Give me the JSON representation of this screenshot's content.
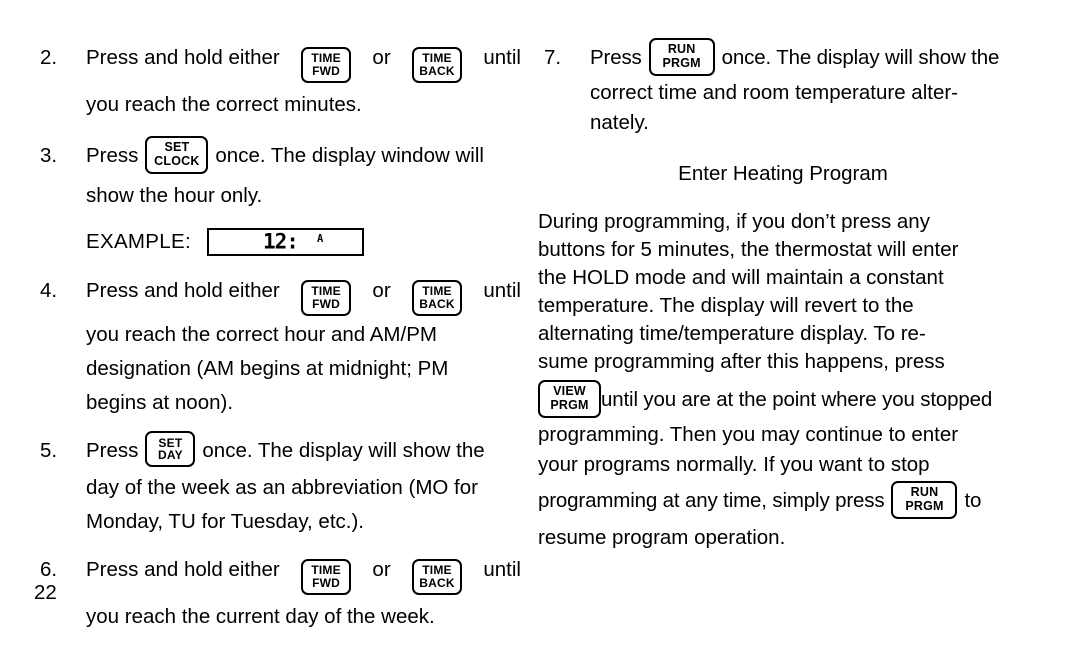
{
  "page": {
    "number": "22",
    "background_color": "#ffffff",
    "text_color": "#000000"
  },
  "keys": {
    "time_fwd": {
      "line1": "TIME",
      "line2": "FWD"
    },
    "time_back": {
      "line1": "TIME",
      "line2": "BACK"
    },
    "set_clock": {
      "line1": "SET",
      "line2": "CLOCK"
    },
    "set_day": {
      "line1": "SET",
      "line2": "DAY"
    },
    "run_prgm": {
      "line1": "RUN",
      "line2": "PRGM"
    },
    "view_prgm": {
      "line1": "VIEW",
      "line2": "PRGM"
    }
  },
  "left_column": {
    "steps": [
      {
        "number": "2.",
        "lines": [
          {
            "pre": "Press and hold either",
            "key": "time_fwd",
            "mid": "or",
            "key2": "time_back",
            "post": "until"
          },
          {
            "text": "you reach the correct minutes."
          }
        ]
      },
      {
        "number": "3.",
        "lines": [
          {
            "pre": "Press",
            "key": "set_clock",
            "post": "once. The display window will"
          },
          {
            "text": "show the hour only."
          }
        ]
      },
      {
        "number": "4.",
        "lines": [
          {
            "pre": "Press and hold either",
            "key": "time_fwd",
            "mid": "or",
            "key2": "time_back",
            "post": "until"
          },
          {
            "text": "you reach the correct hour and AM/PM"
          },
          {
            "text": "designation (AM begins at midnight; PM"
          },
          {
            "text": "begins at noon)."
          }
        ]
      },
      {
        "number": "5.",
        "lines": [
          {
            "pre": "Press",
            "key": "set_day",
            "post": "once. The display will show the"
          },
          {
            "text": "day of the week as an abbreviation (MO for"
          },
          {
            "text": "Monday, TU for Tuesday, etc.)."
          }
        ]
      },
      {
        "number": "6.",
        "lines": [
          {
            "pre": "Press and hold either",
            "key": "time_fwd",
            "mid": "or",
            "key2": "time_back",
            "post": "until"
          },
          {
            "text": "you reach the current day of the week."
          }
        ]
      }
    ],
    "example": {
      "label": "EXAMPLE:",
      "display_time": "12:",
      "display_ampm": "A"
    }
  },
  "right_column": {
    "step7": {
      "number": "7.",
      "lines": [
        {
          "pre": "Press",
          "key": "run_prgm",
          "post": "once. The display will show the"
        },
        {
          "text": "correct time and room temperature alter-"
        },
        {
          "text": "nately."
        }
      ]
    },
    "heading": "Enter Heating Program",
    "paragraph_lines": [
      "During programming, if you don’t press any",
      "buttons for 5 minutes, the thermostat will enter",
      "the HOLD mode and will maintain a constant",
      "temperature.   The  display  will  revert  to  the",
      "alternating time/temperature display.   To re-",
      "sume programming after this happens, press"
    ],
    "resume_lines": [
      {
        "key": "view_prgm",
        "post": "until you are at the point where you stopped"
      },
      {
        "text": "programming.  Then you may continue to enter"
      },
      {
        "text": "your  programs  normally.   If  you  want  to  stop"
      },
      {
        "pre": "programming at any time, simply press",
        "key": "run_prgm",
        "post": "to"
      },
      {
        "text": "resume program operation."
      }
    ]
  }
}
